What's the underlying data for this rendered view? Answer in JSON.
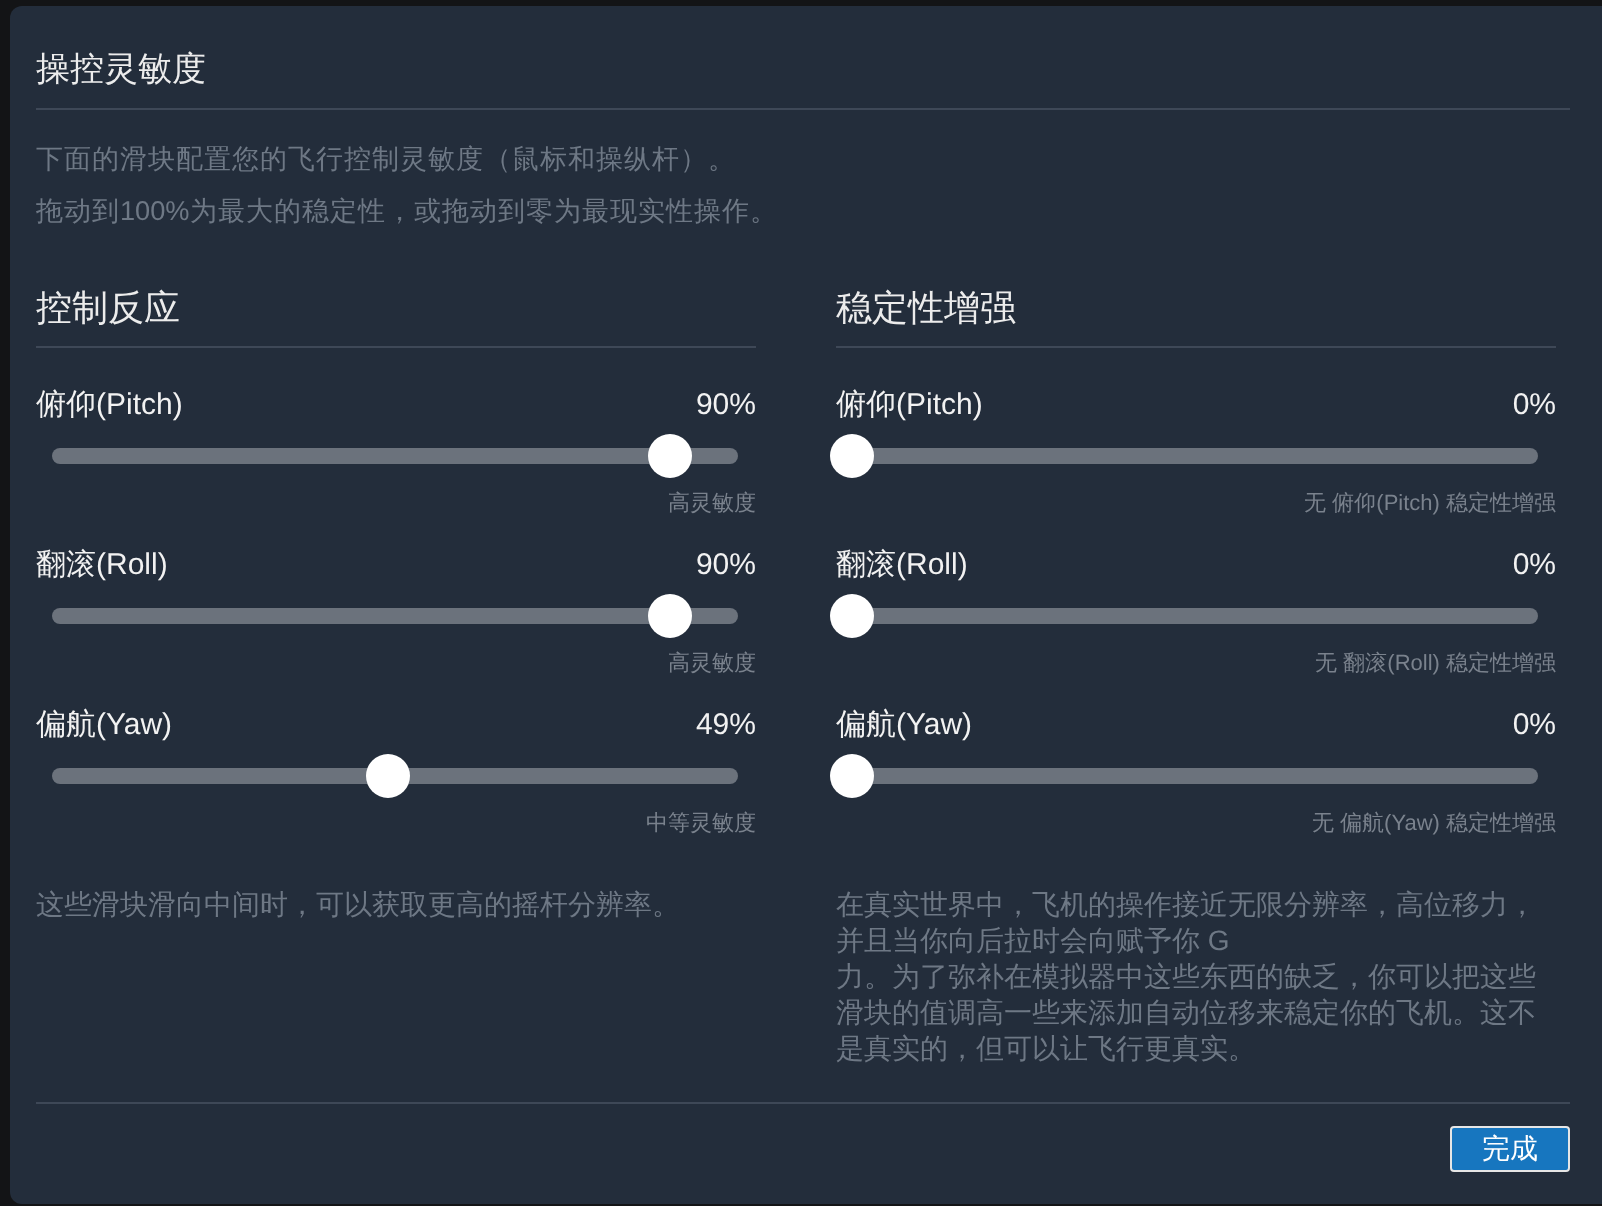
{
  "dialog": {
    "title": "操控灵敏度",
    "description": [
      "下面的滑块配置您的飞行控制灵敏度（鼠标和操纵杆）。",
      "拖动到100%为最大的稳定性，或拖动到零为最现实性操作。"
    ],
    "sections": [
      {
        "heading": "控制反应",
        "sliders": [
          {
            "label": "俯仰(Pitch)",
            "reading": "90%",
            "level": 0.9,
            "caption": "高灵敏度"
          },
          {
            "label": "翻滚(Roll)",
            "reading": "90%",
            "level": 0.9,
            "caption": "高灵敏度"
          },
          {
            "label": "偏航(Yaw)",
            "reading": "49%",
            "level": 0.49,
            "caption": "中等灵敏度"
          }
        ],
        "note": "这些滑块滑向中间时，可以获取更高的摇杆分辨率。"
      },
      {
        "heading": "稳定性增强",
        "sliders": [
          {
            "label": "俯仰(Pitch)",
            "reading": "0%",
            "level": 0,
            "caption": "无 俯仰(Pitch) 稳定性增强"
          },
          {
            "label": "翻滚(Roll)",
            "reading": "0%",
            "level": 0,
            "caption": "无 翻滚(Roll) 稳定性增强"
          },
          {
            "label": "偏航(Yaw)",
            "reading": "0%",
            "level": 0,
            "caption": "无 偏航(Yaw) 稳定性增强"
          }
        ],
        "note": "在真实世界中，飞机的操作接近无限分辨率，高位移力，并且当你向后拉时会向赋予你 G\n力。为了弥补在模拟器中这些东西的缺乏，你可以把这些滑块的值调高一些来添加自动位移来稳定你的飞机。这不是真实的，但可以让飞行更真实。"
      }
    ],
    "buttons": [
      {
        "label": "完成"
      }
    ]
  }
}
